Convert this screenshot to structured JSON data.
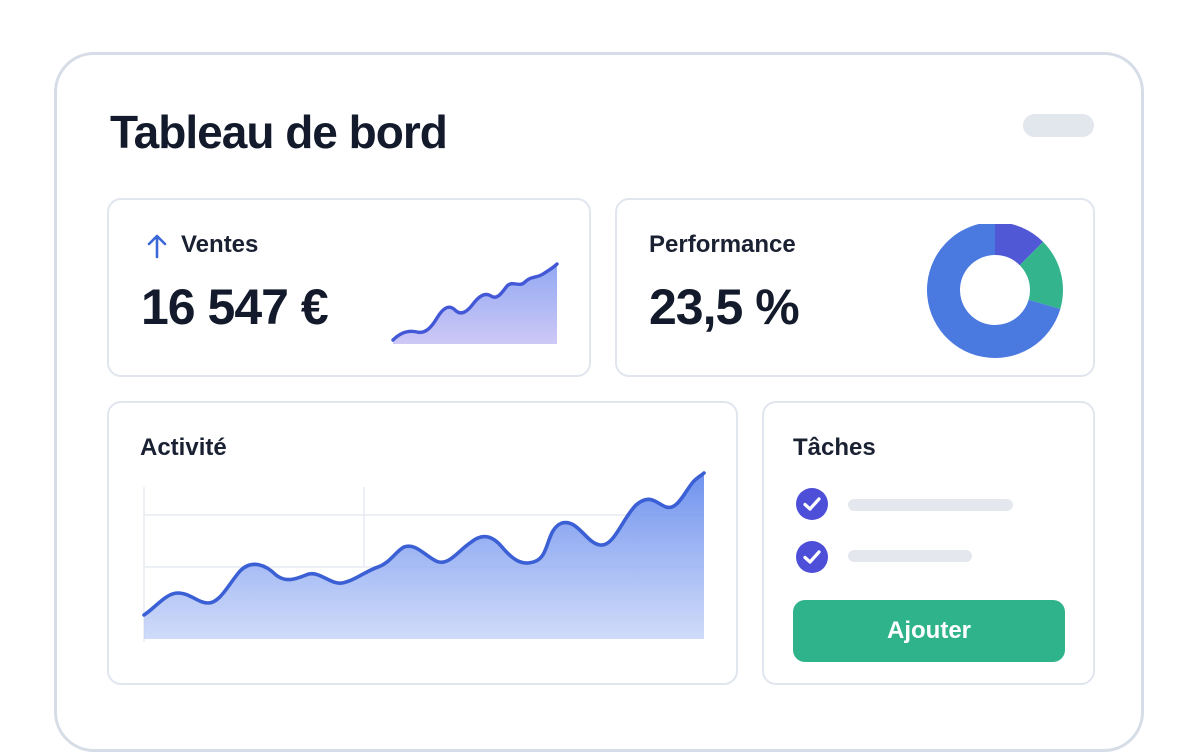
{
  "page": {
    "title": "Tableau de bord"
  },
  "ventes": {
    "label": "Ventes",
    "value": "16 547 €",
    "trend_icon": "arrow-up-icon"
  },
  "performance": {
    "label": "Performance",
    "value": "23,5 %",
    "donut": [
      {
        "name": "slice-indigo",
        "fraction": 0.125,
        "color": "#5158d6"
      },
      {
        "name": "slice-green",
        "fraction": 0.17,
        "color": "#33b48c"
      },
      {
        "name": "slice-blue",
        "fraction": 0.705,
        "color": "#4a79e0"
      }
    ]
  },
  "activite": {
    "label": "Activité"
  },
  "taches": {
    "label": "Tâches",
    "items": [
      {
        "icon": "check-circle-icon"
      },
      {
        "icon": "check-circle-icon"
      }
    ],
    "add_label": "Ajouter"
  },
  "colors": {
    "accent": "#3a5bd0",
    "button": "#2fb38a",
    "check": "#4e4fd8"
  }
}
